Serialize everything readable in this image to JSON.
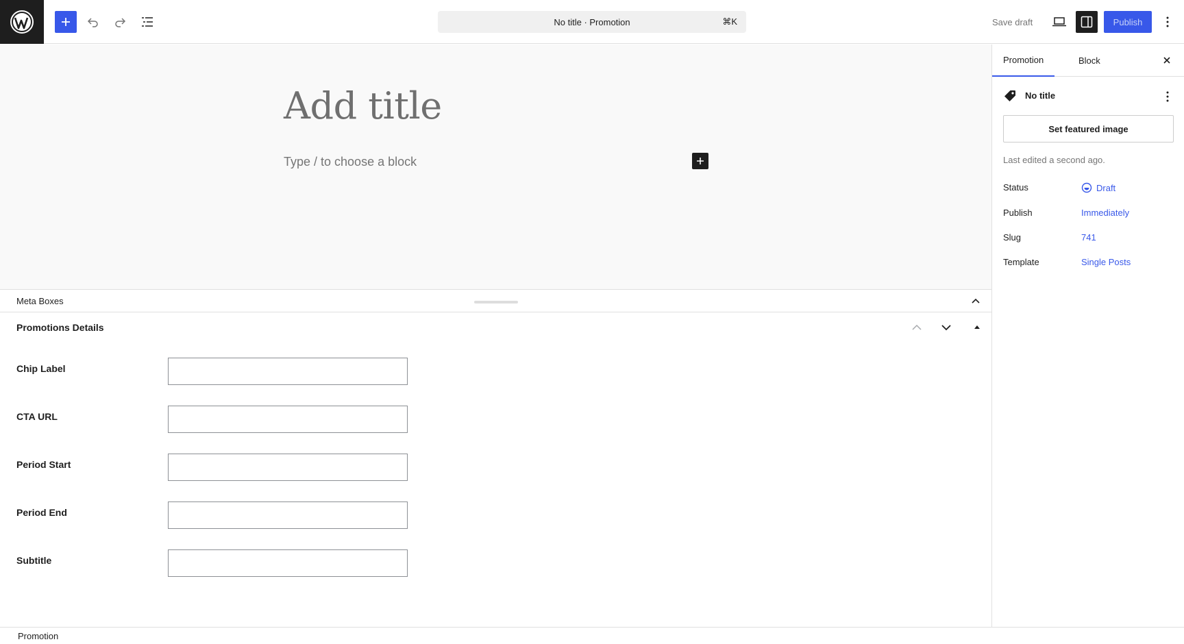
{
  "header": {
    "logo_icon": "wordpress-logo-icon",
    "inserter_icon": "plus-icon",
    "undo_icon": "undo-icon",
    "redo_icon": "redo-icon",
    "document_overview_icon": "list-view-icon",
    "command": {
      "title": "No title",
      "separator": " · ",
      "post_type": "Promotion",
      "shortcut": "⌘K"
    },
    "save_draft_label": "Save draft",
    "preview_icon": "laptop-icon",
    "settings_icon": "sidebar-icon",
    "publish_label": "Publish",
    "more_icon": "vertical-ellipsis-icon"
  },
  "canvas": {
    "title_placeholder": "Add title",
    "block_placeholder": "Type / to choose a block",
    "block_inserter_icon": "plus-icon"
  },
  "meta_boxes": {
    "header_label": "Meta Boxes",
    "toggle_icon": "chevron-up-icon",
    "panel": {
      "title": "Promotions Details",
      "move_up_icon": "chevron-up-icon",
      "move_down_icon": "chevron-down-icon",
      "toggle_icon": "triangle-up-icon",
      "fields": [
        {
          "label": "Chip Label",
          "value": ""
        },
        {
          "label": "CTA URL",
          "value": ""
        },
        {
          "label": "Period Start",
          "value": ""
        },
        {
          "label": "Period End",
          "value": ""
        },
        {
          "label": "Subtitle",
          "value": ""
        }
      ]
    }
  },
  "sidebar": {
    "tabs": [
      {
        "label": "Promotion",
        "active": true
      },
      {
        "label": "Block",
        "active": false
      }
    ],
    "close_icon": "close-icon",
    "post_card": {
      "icon": "tag-icon",
      "title": "No title",
      "menu_icon": "vertical-ellipsis-icon"
    },
    "featured_image_label": "Set featured image",
    "last_edited": "Last edited a second ago.",
    "rows": [
      {
        "label": "Status",
        "value": "Draft",
        "icon": "draft-status-icon"
      },
      {
        "label": "Publish",
        "value": "Immediately"
      },
      {
        "label": "Slug",
        "value": "741"
      },
      {
        "label": "Template",
        "value": "Single Posts"
      }
    ]
  },
  "footer": {
    "breadcrumb": "Promotion"
  },
  "colors": {
    "accent": "#3858e9",
    "dark": "#1e1e1e",
    "muted": "#757575",
    "canvas_bg": "#f9f9f9"
  }
}
